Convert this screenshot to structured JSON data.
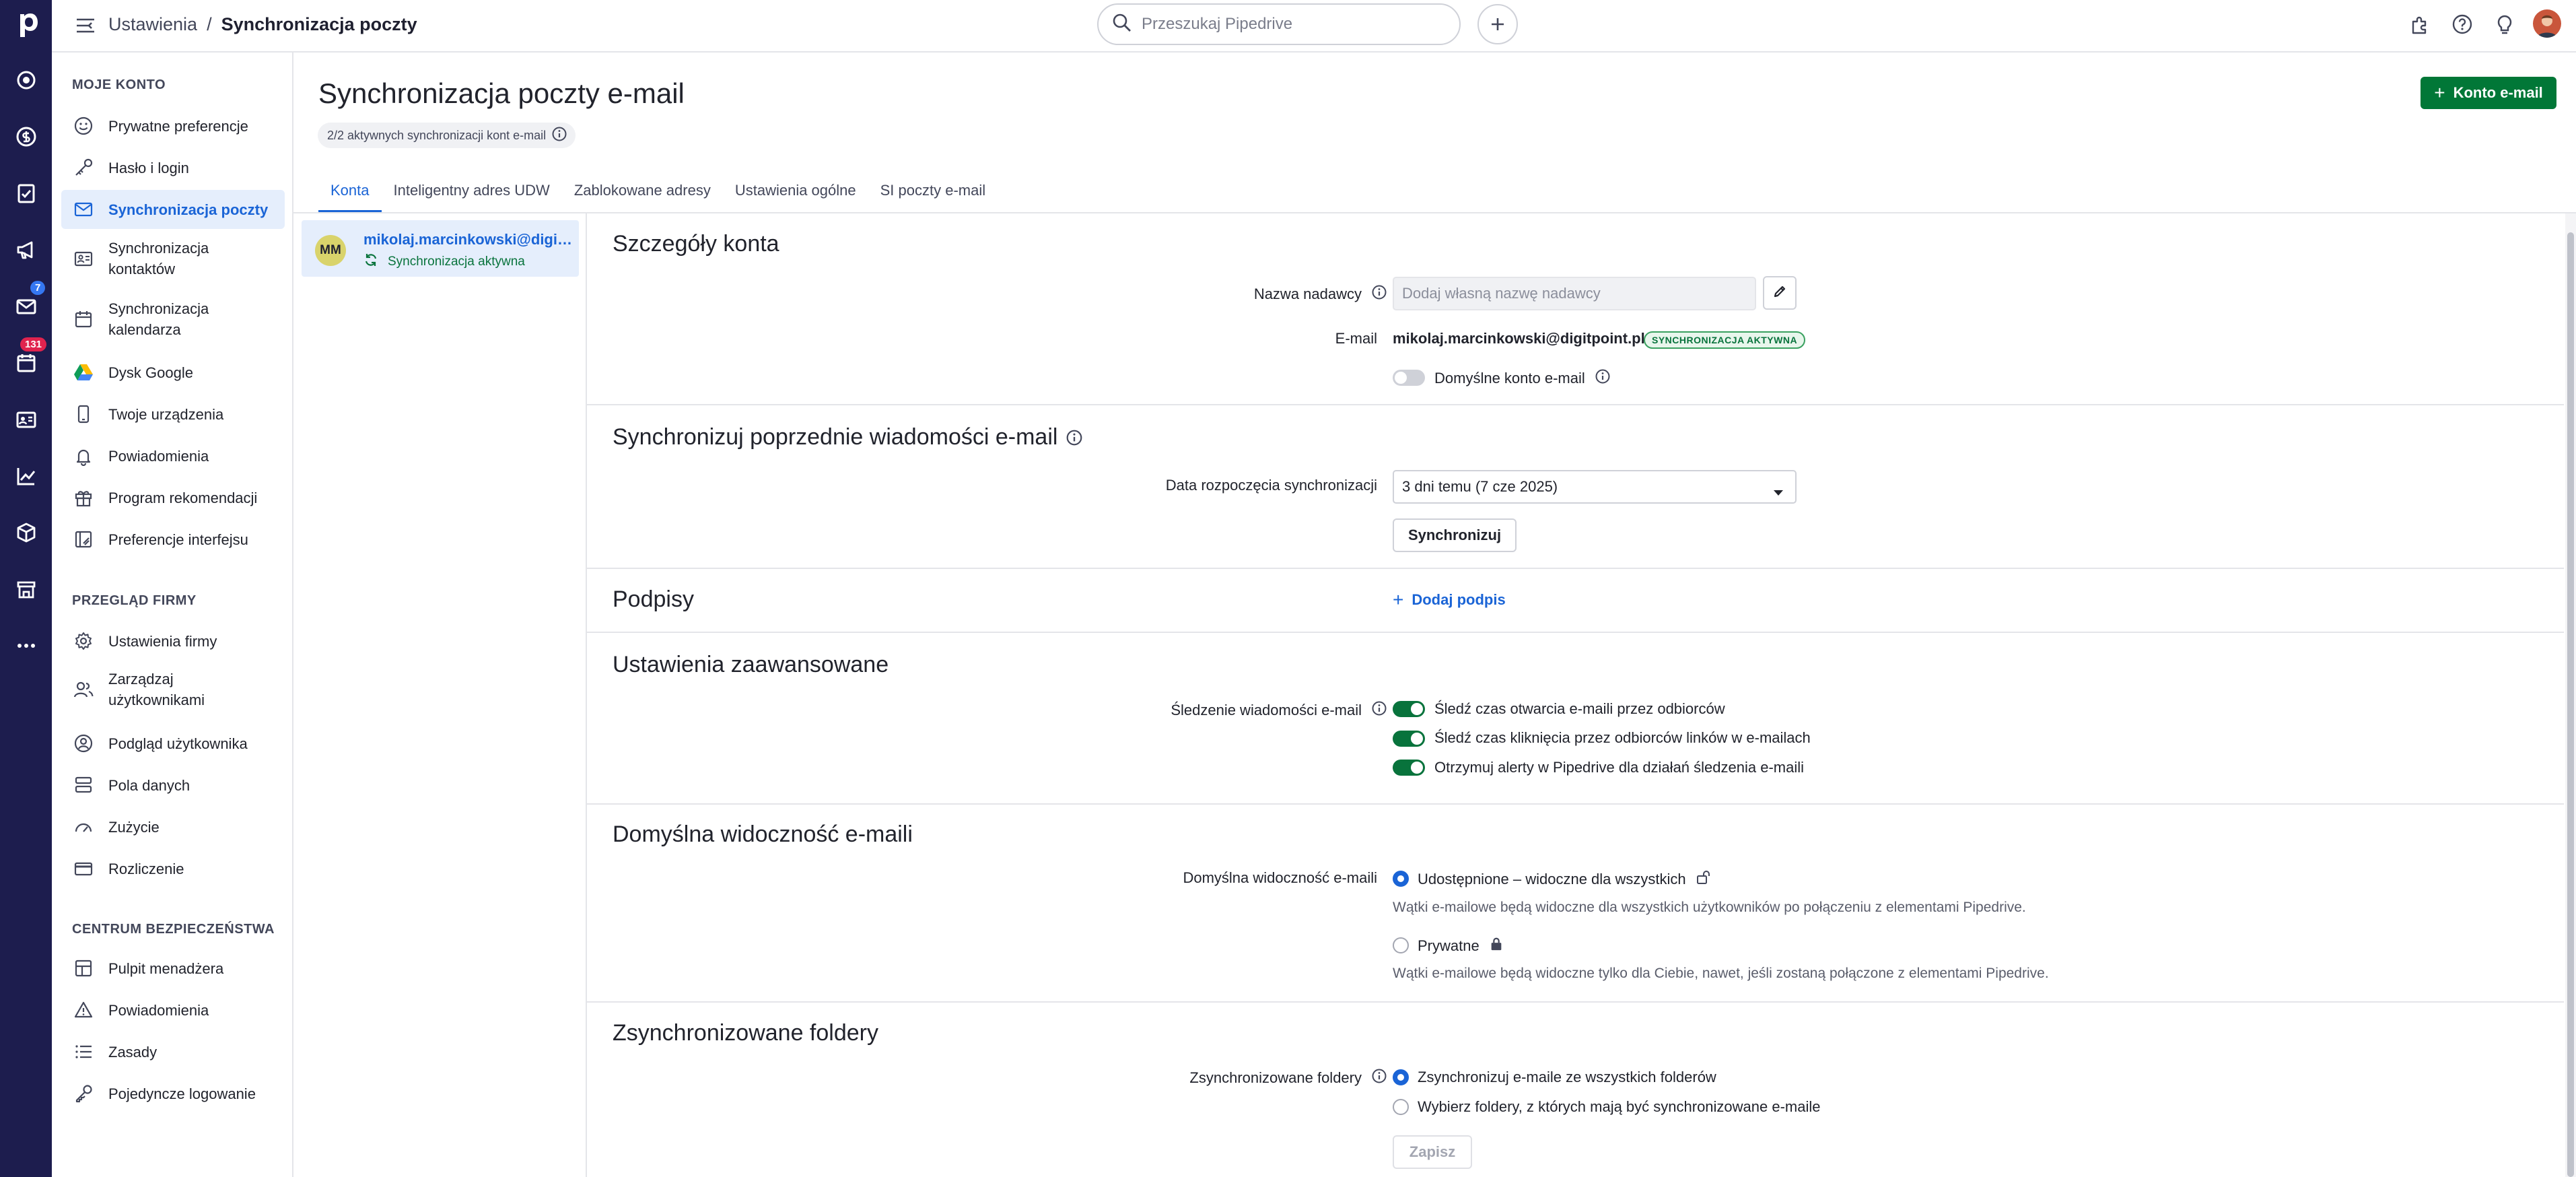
{
  "header": {
    "breadcrumb_parent": "Ustawienia",
    "breadcrumb_separator": "/",
    "breadcrumb_current": "Synchronizacja poczty",
    "search_placeholder": "Przeszukaj Pipedrive"
  },
  "rail": {
    "logo": "p",
    "badges": {
      "mail": "7",
      "activities": "131"
    },
    "icons": [
      "leads-icon",
      "deals-icon",
      "tasks-icon",
      "campaigns-icon",
      "mail-icon",
      "activities-icon",
      "contacts-icon",
      "insights-icon",
      "products-icon",
      "marketplace-icon",
      "more-icon"
    ]
  },
  "sidebar": {
    "sections": [
      {
        "title": "MOJE KONTO",
        "items": [
          {
            "label": "Prywatne preferencje",
            "icon": "smile-icon"
          },
          {
            "label": "Hasło i login",
            "icon": "key-icon"
          },
          {
            "label": "Synchronizacja poczty",
            "icon": "mail-icon",
            "active": true
          },
          {
            "label": "Synchronizacja kontaktów",
            "icon": "contact-card-icon"
          },
          {
            "label": "Synchronizacja kalendarza",
            "icon": "calendar-icon"
          },
          {
            "label": "Dysk Google",
            "icon": "google-drive-icon"
          },
          {
            "label": "Twoje urządzenia",
            "icon": "phone-icon"
          },
          {
            "label": "Powiadomienia",
            "icon": "bell-icon"
          },
          {
            "label": "Program rekomendacji",
            "icon": "gift-icon"
          },
          {
            "label": "Preferencje interfejsu",
            "icon": "interface-icon"
          }
        ]
      },
      {
        "title": "PRZEGLĄD FIRMY",
        "items": [
          {
            "label": "Ustawienia firmy",
            "icon": "gear-icon"
          },
          {
            "label": "Zarządzaj użytkownikami",
            "icon": "users-icon"
          },
          {
            "label": "Podgląd użytkownika",
            "icon": "user-view-icon"
          },
          {
            "label": "Pola danych",
            "icon": "data-fields-icon"
          },
          {
            "label": "Zużycie",
            "icon": "gauge-icon"
          },
          {
            "label": "Rozliczenie",
            "icon": "credit-card-icon"
          }
        ]
      },
      {
        "title": "CENTRUM BEZPIECZEŃSTWA",
        "items": [
          {
            "label": "Pulpit menadżera",
            "icon": "dashboard-icon"
          },
          {
            "label": "Powiadomienia",
            "icon": "warning-icon"
          },
          {
            "label": "Zasady",
            "icon": "list-icon"
          },
          {
            "label": "Pojedyncze logowanie",
            "icon": "sso-key-icon"
          }
        ]
      }
    ]
  },
  "main": {
    "title": "Synchronizacja poczty e-mail",
    "sync_status": "2/2 aktywnych synchronizacji kont e-mail",
    "add_account_button": "Konto e-mail",
    "tabs": [
      "Konta",
      "Inteligentny adres UDW",
      "Zablokowane adresy",
      "Ustawienia ogólne",
      "SI poczty e-mail"
    ],
    "active_tab": "Konta"
  },
  "account": {
    "initials": "MM",
    "email": "mikolaj.marcinkowski@digitpoint.pl",
    "status": "Synchronizacja aktywna"
  },
  "details": {
    "account_section": {
      "title": "Szczegóły konta",
      "sender_label": "Nazwa nadawcy",
      "sender_placeholder": "Dodaj własną nazwę nadawcy",
      "email_label": "E-mail",
      "email_value": "mikolaj.marcinkowski@digitpoint.pl",
      "email_badge": "SYNCHRONIZACJA AKTYWNA",
      "default_account_label": "Domyślne konto e-mail",
      "default_account_enabled": false
    },
    "history_section": {
      "title": "Synchronizuj poprzednie wiadomości e-mail",
      "start_date_label": "Data rozpoczęcia synchronizacji",
      "start_date_value": "3 dni temu (7 cze 2025)",
      "sync_button": "Synchronizuj"
    },
    "signatures_section": {
      "title": "Podpisy",
      "add_signature": "Dodaj podpis"
    },
    "advanced_section": {
      "title": "Ustawienia zaawansowane",
      "tracking_label": "Śledzenie wiadomości e-mail",
      "options": [
        {
          "label": "Śledź czas otwarcia e-maili przez odbiorców",
          "enabled": true
        },
        {
          "label": "Śledź czas kliknięcia przez odbiorców linków w e-mailach",
          "enabled": true
        },
        {
          "label": "Otrzymuj alerty w Pipedrive dla działań śledzenia e-maili",
          "enabled": true
        }
      ]
    },
    "visibility_section": {
      "title": "Domyślna widoczność e-maili",
      "label": "Domyślna widoczność e-maili",
      "shared_label": "Udostępnione – widoczne dla wszystkich",
      "shared_hint": "Wątki e-mailowe będą widoczne dla wszystkich użytkowników po połączeniu z elementami Pipedrive.",
      "private_label": "Prywatne",
      "private_hint": "Wątki e-mailowe będą widoczne tylko dla Ciebie, nawet, jeśli zostaną połączone z elementami Pipedrive.",
      "selected": "shared"
    },
    "folders_section": {
      "title": "Zsynchronizowane foldery",
      "label": "Zsynchronizowane foldery",
      "all_label": "Zsynchronizuj e-maile ze wszystkich folderów",
      "choose_label": "Wybierz foldery, z których mają być synchronizowane e-maile",
      "selected": "all",
      "save_button": "Zapisz"
    }
  },
  "colors": {
    "rail_bg": "#1d1d4e",
    "accent_blue": "#1a64d6",
    "primary_green": "#017737",
    "toggle_on": "#08733c"
  }
}
